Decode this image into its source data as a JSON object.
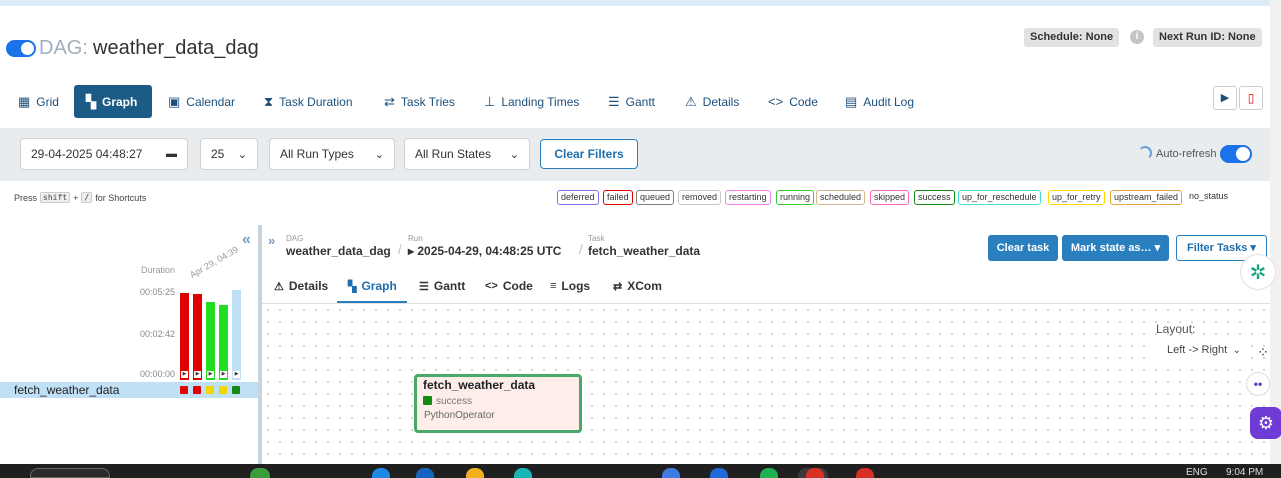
{
  "header": {
    "dag_prefix": "DAG:",
    "dag_name": "weather_data_dag",
    "schedule": "Schedule: None",
    "next_run": "Next Run ID: None",
    "info_glyph": "i"
  },
  "nav": {
    "tabs": [
      {
        "label": "Grid",
        "icon": "grid-icon"
      },
      {
        "label": "Graph",
        "icon": "graph-icon"
      },
      {
        "label": "Calendar",
        "icon": "calendar-icon"
      },
      {
        "label": "Task Duration",
        "icon": "hourglass-icon"
      },
      {
        "label": "Task Tries",
        "icon": "retry-icon"
      },
      {
        "label": "Landing Times",
        "icon": "landing-icon"
      },
      {
        "label": "Gantt",
        "icon": "gantt-icon"
      },
      {
        "label": "Details",
        "icon": "warning-icon"
      },
      {
        "label": "Code",
        "icon": "code-icon"
      },
      {
        "label": "Audit Log",
        "icon": "audit-icon"
      }
    ],
    "active": "Graph",
    "play_glyph": "▶",
    "delete_glyph": "🗑"
  },
  "filters": {
    "date": "29-04-2025 04:48:27",
    "count": "25",
    "run_types": "All Run Types",
    "run_states": "All Run States",
    "clear": "Clear Filters",
    "auto_refresh": "Auto-refresh"
  },
  "shortcuts": {
    "prefix": "Press",
    "key1": "shift",
    "plus": "+",
    "key2": "/",
    "suffix": "for Shortcuts"
  },
  "legend": [
    {
      "label": "deferred",
      "color": "#8a6de0"
    },
    {
      "label": "failed",
      "color": "#e00000"
    },
    {
      "label": "queued",
      "color": "#808080"
    },
    {
      "label": "removed",
      "color": "#c8c8c8"
    },
    {
      "label": "restarting",
      "color": "#ee82ee"
    },
    {
      "label": "running",
      "color": "#32cd32"
    },
    {
      "label": "scheduled",
      "color": "#d2b48c"
    },
    {
      "label": "skipped",
      "color": "#ff69b4"
    },
    {
      "label": "success",
      "color": "#138a13"
    },
    {
      "label": "up_for_reschedule",
      "color": "#40e0d0"
    },
    {
      "label": "up_for_retry",
      "color": "#ffd700"
    },
    {
      "label": "upstream_failed",
      "color": "#e6a23c"
    },
    {
      "label": "no_status",
      "color": "none"
    }
  ],
  "grid": {
    "duration_label": "Duration",
    "ticks": [
      "00:05:25",
      "00:02:42",
      "00:00:00"
    ],
    "run_date": "Apr 29, 04:39",
    "bars": [
      {
        "fraction": 0.95,
        "color": "#e00000"
      },
      {
        "fraction": 0.94,
        "color": "#e00000"
      },
      {
        "fraction": 0.85,
        "color": "#22dd22"
      },
      {
        "fraction": 0.81,
        "color": "#22dd22"
      },
      {
        "fraction": 0.98,
        "color": "#bfe0f5"
      }
    ],
    "task_label": "fetch_weather_data",
    "task_states": [
      "#e00000",
      "#e00000",
      "#f2d600",
      "#f2d600",
      "#138a13"
    ],
    "play_glyph": "▶"
  },
  "breadcrumb": {
    "dag_label": "DAG",
    "dag_value": "weather_data_dag",
    "run_label": "Run",
    "run_value": "▸ 2025-04-29, 04:48:25 UTC",
    "task_label": "Task",
    "task_value": "fetch_weather_data",
    "sep": "/"
  },
  "actions": {
    "clear_task": "Clear task",
    "mark_state": "Mark state as… ▾",
    "filter_tasks": "Filter Tasks ▾"
  },
  "detail_tabs": [
    {
      "label": "Details",
      "icon": "⚠"
    },
    {
      "label": "Graph",
      "icon": "▚"
    },
    {
      "label": "Gantt",
      "icon": "☰"
    },
    {
      "label": "Code",
      "icon": "<>"
    },
    {
      "label": "Logs",
      "icon": "≡"
    },
    {
      "label": "XCom",
      "icon": "⇄"
    }
  ],
  "graph": {
    "node_title": "fetch_weather_data",
    "node_state": "success",
    "node_operator": "PythonOperator",
    "layout_label": "Layout:",
    "layout_value": "Left -> Right"
  },
  "taskbar": {
    "lang": "ENG",
    "time": "9:04 PM"
  }
}
